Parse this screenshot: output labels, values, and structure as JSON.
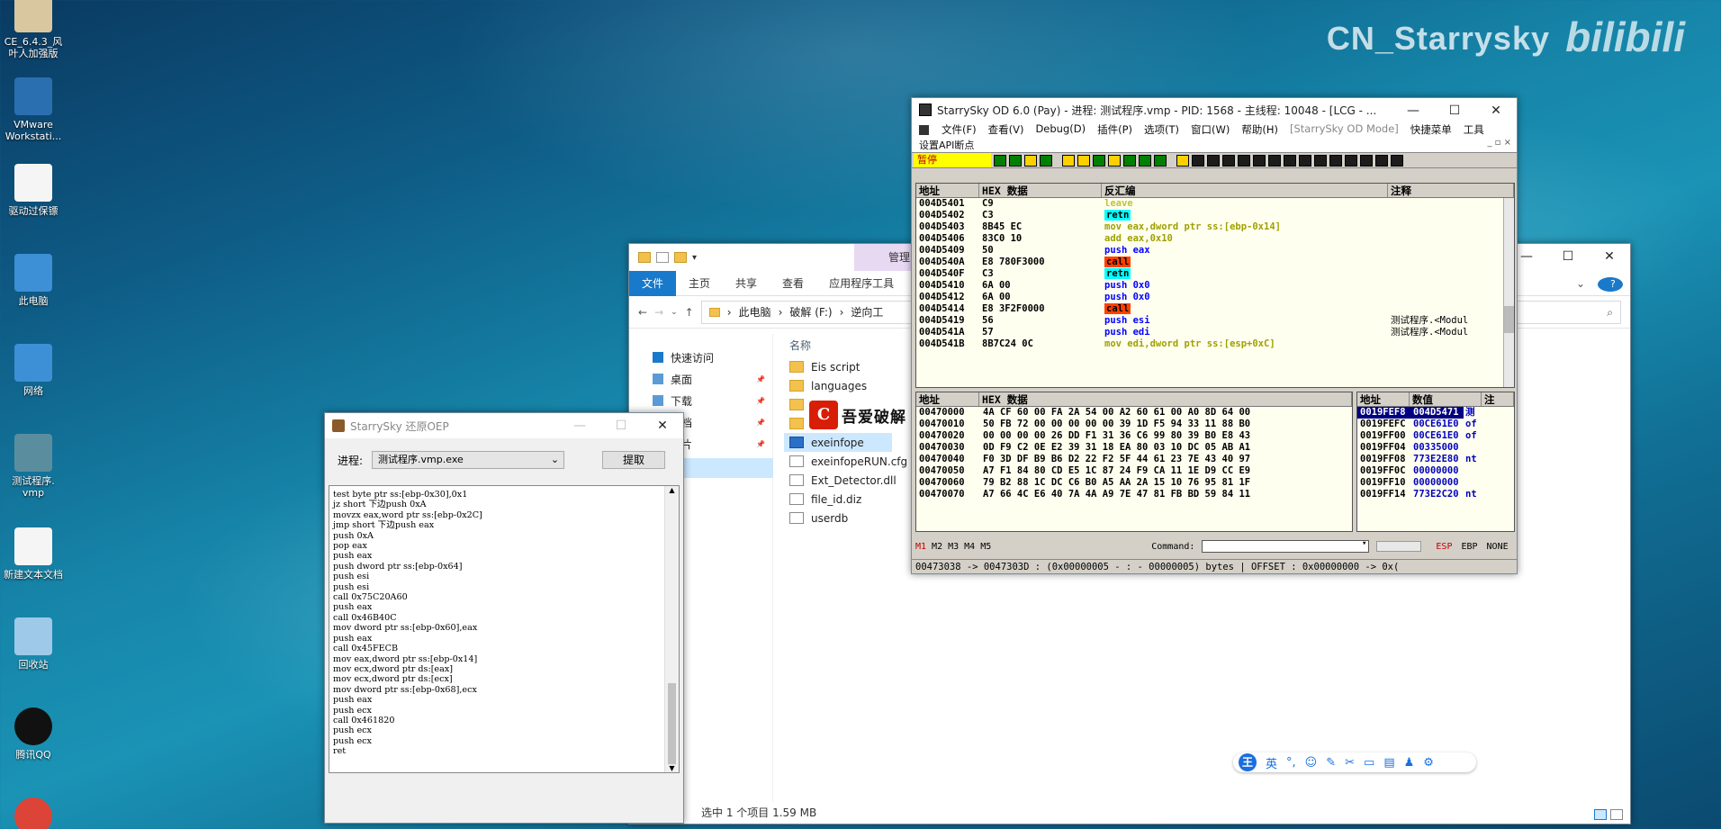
{
  "overlay": {
    "channel": "CN_Starrysky",
    "brand": "bilibili"
  },
  "desktop": {
    "icons": [
      {
        "label": "CE_6.4.3_风\n叶人加强版",
        "kind": "ce"
      },
      {
        "label": "VMware\nWorkstati...",
        "kind": "vmware"
      },
      {
        "label": "驱动过保镖",
        "kind": "file"
      },
      {
        "label": "此电脑",
        "kind": "pc"
      },
      {
        "label": "网络",
        "kind": "network"
      },
      {
        "label": "测试程序.\nvmp",
        "kind": "vmp"
      },
      {
        "label": "新建文本文档",
        "kind": "file"
      },
      {
        "label": "回收站",
        "kind": "recycle"
      },
      {
        "label": "腾讯QQ",
        "kind": "qq"
      },
      {
        "label": "",
        "kind": "chrome"
      }
    ]
  },
  "explorer": {
    "manage_label": "管理",
    "tabs": [
      "文件",
      "主页",
      "共享",
      "查看",
      "应用程序工具"
    ],
    "breadcrumb": [
      "此电脑",
      "破解 (F:)",
      "逆向工"
    ],
    "column_name": "名称",
    "nav": [
      {
        "label": "快速访问",
        "icon": "star-icon"
      },
      {
        "label": "桌面",
        "icon": "desktop-icon"
      },
      {
        "label": "下载",
        "icon": "download-icon"
      },
      {
        "label": "文档",
        "icon": "doc-icon"
      },
      {
        "label": "图片",
        "icon": "picture-icon"
      }
    ],
    "files": [
      {
        "name": "Eis script",
        "type": "folder"
      },
      {
        "name": "languages",
        "type": "folder"
      },
      {
        "name": "",
        "type": "folder"
      },
      {
        "name": "",
        "type": "folder"
      },
      {
        "name": "exeinfope",
        "type": "exe"
      },
      {
        "name": "exeinfopeRUN.cfg",
        "type": "doc"
      },
      {
        "name": "Ext_Detector.dll",
        "type": "doc"
      },
      {
        "name": "file_id.diz",
        "type": "doc"
      },
      {
        "name": "userdb",
        "type": "doc"
      }
    ],
    "status": "选中 1 个项目   1.59 MB",
    "logo_text": "吾爱破解"
  },
  "od": {
    "title": "StarrySky OD 6.0 (Pay) - 进程: 测试程序.vmp - PID: 1568 - 主线程: 10048 - [LCG - ...",
    "menu": [
      "文件(F)",
      "查看(V)",
      "Debug(D)",
      "插件(P)",
      "选项(T)",
      "窗口(W)",
      "帮助(H)",
      "[StarrySky OD Mode]",
      "快捷菜单",
      "工具"
    ],
    "submenu": "设置API断点",
    "pause_label": "暂停",
    "disasm_headers": [
      "地址",
      "HEX 数据",
      "反汇编",
      "注释"
    ],
    "disasm": [
      {
        "addr": "004D5401",
        "hex": "C9",
        "asm": "leave",
        "cls": "m-leave",
        "comment": ""
      },
      {
        "addr": "004D5402",
        "hex": "C3",
        "asm": "retn",
        "cls": "m-ret",
        "comment": ""
      },
      {
        "addr": "004D5403",
        "hex": "8B45 EC",
        "asm": "mov eax,dword ptr ss:[ebp-0x14]",
        "cls": "m-mov",
        "comment": ""
      },
      {
        "addr": "004D5406",
        "hex": "83C0 10",
        "asm": "add eax,0x10",
        "cls": "m-mov",
        "comment": ""
      },
      {
        "addr": "004D5409",
        "hex": "50",
        "asm": "push eax",
        "cls": "m-push",
        "comment": ""
      },
      {
        "addr": "004D540A",
        "hex": "E8 780F3000",
        "asm": "call",
        "cls": "m-call",
        "comment": ""
      },
      {
        "addr": "004D540F",
        "hex": "C3",
        "asm": "retn",
        "cls": "m-ret",
        "comment": ""
      },
      {
        "addr": "004D5410",
        "hex": "6A 00",
        "asm": "push 0x0",
        "cls": "m-push",
        "comment": ""
      },
      {
        "addr": "004D5412",
        "hex": "6A 00",
        "asm": "push 0x0",
        "cls": "m-push",
        "comment": ""
      },
      {
        "addr": "004D5414",
        "hex": "E8 3F2F0000",
        "asm": "call",
        "cls": "m-call",
        "comment": ""
      },
      {
        "addr": "004D5419",
        "hex": "56",
        "asm": "push esi",
        "cls": "m-push",
        "comment": "测试程序.<Modul"
      },
      {
        "addr": "004D541A",
        "hex": "57",
        "asm": "push edi",
        "cls": "m-push",
        "comment": "测试程序.<Modul"
      },
      {
        "addr": "004D541B",
        "hex": "8B7C24 0C",
        "asm": "mov edi,dword ptr ss:[esp+0xC]",
        "cls": "m-mov",
        "comment": ""
      }
    ],
    "dump_headers": [
      "地址",
      "HEX 数据"
    ],
    "dump": [
      {
        "addr": "00470000",
        "bytes": "4A CF 60 00 FA 2A 54 00 A2 60 61 00 A0 8D 64 00"
      },
      {
        "addr": "00470010",
        "bytes": "50 FB 72 00 00 00 00 00 39 1D F5 94 33 11 88 B0"
      },
      {
        "addr": "00470020",
        "bytes": "00 00 00 00 26 DD F1 31 36 C6 99 80 39 B0 E8 43"
      },
      {
        "addr": "00470030",
        "bytes": "0D F9 C2 0E E2 39 31 18 EA 80 03 10 DC 05 AB A1"
      },
      {
        "addr": "00470040",
        "bytes": "F0 3D DF B9 B6 D2 22 F2 5F 44 61 23 7E 43 40 97"
      },
      {
        "addr": "00470050",
        "bytes": "A7 F1 84 80 CD E5 1C 87 24 F9 CA 11 1E D9 CC E9"
      },
      {
        "addr": "00470060",
        "bytes": "79 B2 88 1C DC C6 B0 A5 AA 2A 15 10 76 95 81 1F"
      },
      {
        "addr": "00470070",
        "bytes": "A7 66 4C E6 40 7A 4A A9 7E 47 81 FB BD 59 84 11"
      }
    ],
    "stack_headers": [
      "地址",
      "数值",
      "注"
    ],
    "stack": [
      {
        "addr": "0019FEF8",
        "val": "004D5471",
        "cmt": "测"
      },
      {
        "addr": "0019FEFC",
        "val": "00CE61E0",
        "cmt": "of"
      },
      {
        "addr": "0019FF00",
        "val": "00CE61E0",
        "cmt": "of"
      },
      {
        "addr": "0019FF04",
        "val": "00335000",
        "cmt": ""
      },
      {
        "addr": "0019FF08",
        "val": "773E2E80",
        "cmt": "nt"
      },
      {
        "addr": "0019FF0C",
        "val": "00000000",
        "cmt": ""
      },
      {
        "addr": "0019FF10",
        "val": "00000000",
        "cmt": ""
      },
      {
        "addr": "0019FF14",
        "val": "773E2C20",
        "cmt": "nt"
      }
    ],
    "cmd_tabs": [
      "M1",
      "M2",
      "M3",
      "M4",
      "M5"
    ],
    "command_label": "Command:",
    "reg_buttons": [
      "ESP",
      "EBP",
      "NONE"
    ],
    "status": "00473038 -> 0047303D : (0x00000005 - : - 00000005) bytes  |  OFFSET : 0x00000000 -> 0x("
  },
  "oep": {
    "title": "StarrySky 还原OEP",
    "process_label": "进程:",
    "process_value": "测试程序.vmp.exe",
    "extract_button": "提取",
    "code": "test byte ptr ss:[ebp-0x30],0x1\njz short 下边push 0xA\nmovzx eax,word ptr ss:[ebp-0x2C]\njmp short 下边push eax\npush 0xA\npop eax\npush eax\npush dword ptr ss:[ebp-0x64]\npush esi\npush esi\ncall 0x75C20A60\npush eax\ncall 0x46B40C\nmov dword ptr ss:[ebp-0x60],eax\npush eax\ncall 0x45FECB\nmov eax,dword ptr ss:[ebp-0x14]\nmov ecx,dword ptr ds:[eax]\nmov ecx,dword ptr ds:[ecx]\nmov dword ptr ss:[ebp-0x68],ecx\npush eax\npush ecx\ncall 0x461820\npush ecx\npush ecx\nret"
  },
  "ime": {
    "mode": "英"
  }
}
